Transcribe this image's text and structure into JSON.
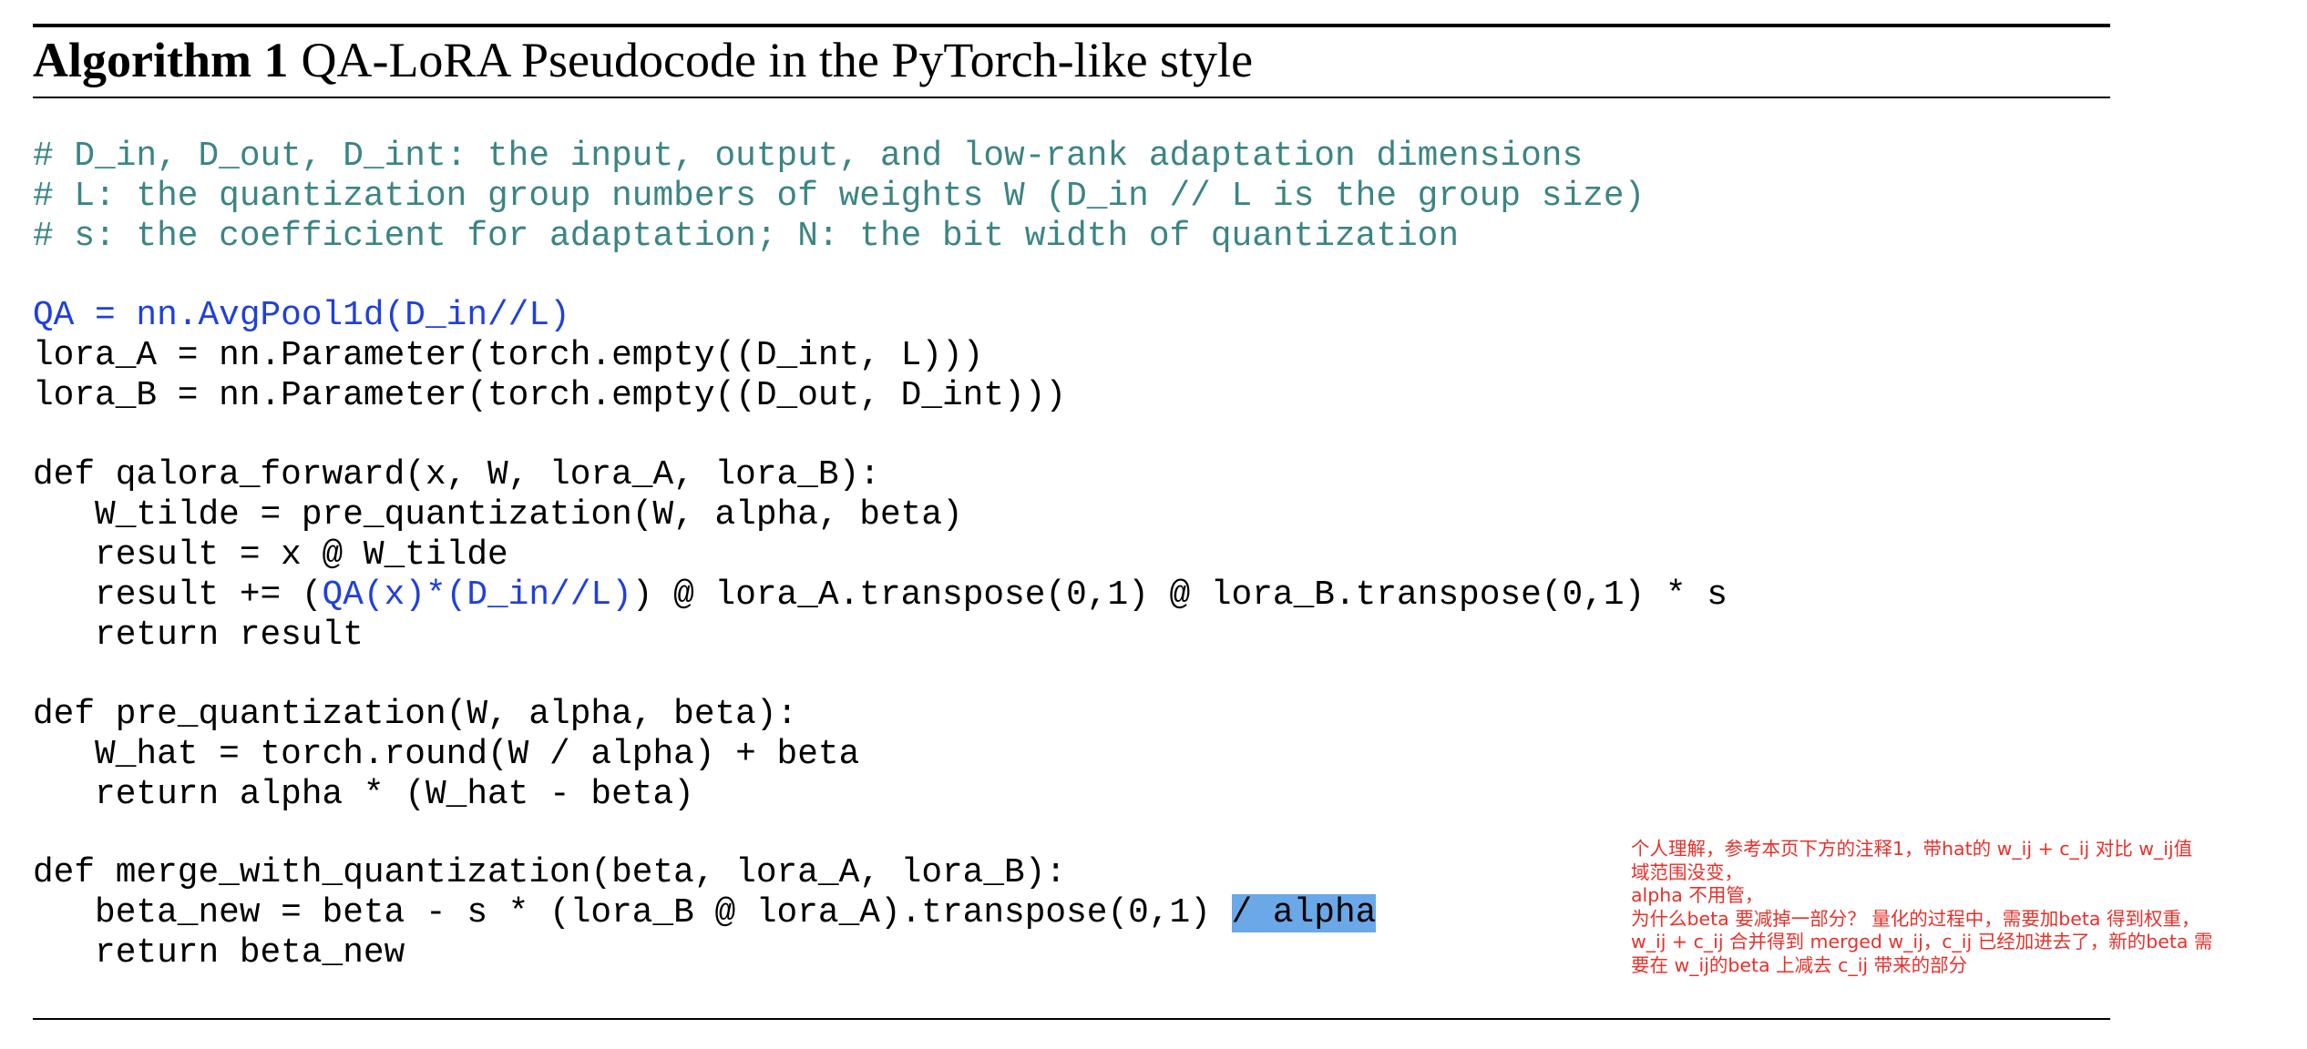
{
  "algorithm": {
    "label": "Algorithm",
    "number": "1",
    "title": "QA-LoRA Pseudocode in the PyTorch-like style"
  },
  "code": {
    "comment_1": "# D_in, D_out, D_int: the input, output, and low-rank adaptation dimensions",
    "comment_2": "# L: the quantization group numbers of weights W (D_in // L is the group size)",
    "comment_3": "# s: the coefficient for adaptation; N: the bit width of quantization",
    "qa_def": "QA = nn.AvgPool1d(D_in//L)",
    "lora_a_def": "lora_A = nn.Parameter(torch.empty((D_int, L)))",
    "lora_b_def": "lora_B = nn.Parameter(torch.empty((D_out, D_int)))",
    "forward_sig": "def qalora_forward(x, W, lora_A, lora_B):",
    "forward_l1": "   W_tilde = pre_quantization(W, alpha, beta)",
    "forward_l2": "   result = x @ W_tilde",
    "forward_l3_pre": "   result += (",
    "forward_l3_blue": "QA(x)*(D_in//L)",
    "forward_l3_post": ") @ lora_A.transpose(0,1) @ lora_B.transpose(0,1) * s",
    "forward_l4": "   return result",
    "preq_sig": "def pre_quantization(W, alpha, beta):",
    "preq_l1": "   W_hat = torch.round(W / alpha) + beta",
    "preq_l2": "   return alpha * (W_hat - beta)",
    "merge_sig": "def merge_with_quantization(beta, lora_A, lora_B):",
    "merge_l1_pre": "   beta_new = beta - s * (lora_B @ lora_A).transpose(0,1) ",
    "merge_l1_hl": "/ alpha",
    "merge_l2": "   return beta_new"
  },
  "annotation": {
    "line_1": "个人理解，参考本页下方的注释1，带hat的 w_ij + c_ij  对比 w_ij值",
    "line_2": "域范围没变，",
    "line_3": "alpha 不用管，",
    "line_4": "为什么beta 要减掉一部分？ 量化的过程中，需要加beta 得到权重，",
    "line_5": "w_ij + c_ij 合并得到 merged w_ij，c_ij 已经加进去了，新的beta 需",
    "line_6": "要在 w_ij的beta 上减去 c_ij 带来的部分",
    "color": "#e8302a"
  },
  "colors": {
    "comment": "#3b8584",
    "highlight_code": "#1f3fe0",
    "selection": "#6aa8e8"
  }
}
